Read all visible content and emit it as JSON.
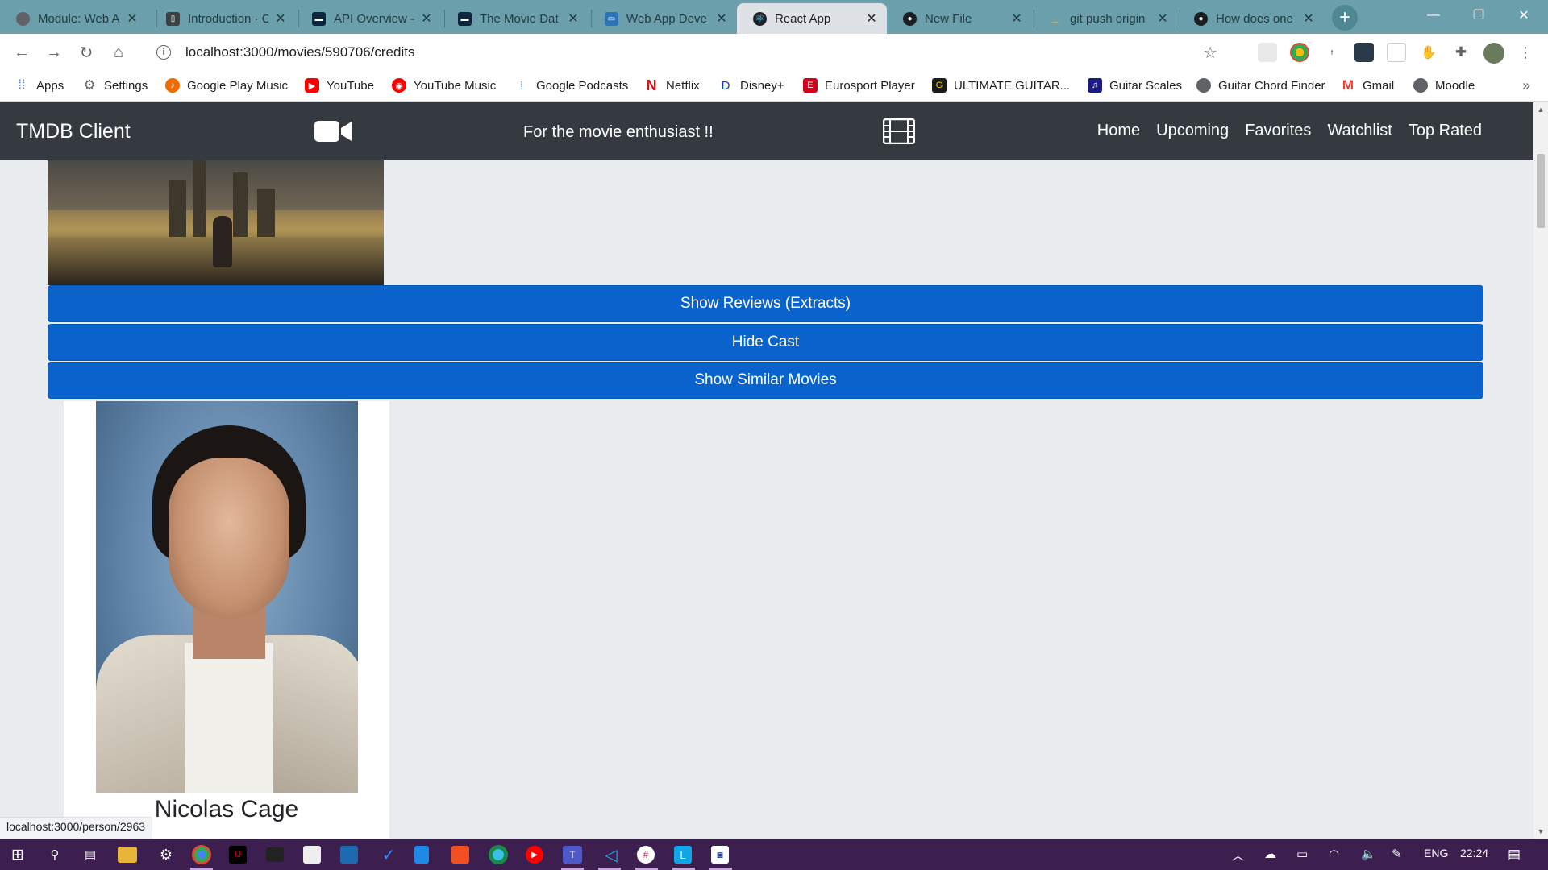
{
  "browser": {
    "tabs": [
      {
        "title": "Module: Web A",
        "favicon": "chrome-globe-icon",
        "color": "#5f6368"
      },
      {
        "title": "Introduction · C",
        "favicon": "book-icon",
        "color": "#3c4043"
      },
      {
        "title": "API Overview –",
        "favicon": "tmdb-icon",
        "color": "#0d253f"
      },
      {
        "title": "The Movie Dat",
        "favicon": "tmdb-icon",
        "color": "#0d253f"
      },
      {
        "title": "Web App Deve",
        "favicon": "moodle-course-icon",
        "color": "#2d73b8"
      },
      {
        "title": "React App",
        "favicon": "react-icon",
        "color": "#61dafb"
      },
      {
        "title": "New File",
        "favicon": "github-icon",
        "color": "#1b1f23"
      },
      {
        "title": "git push origin",
        "favicon": "generic-page-icon",
        "color": "#f0a040"
      },
      {
        "title": "How does one",
        "favicon": "github-icon",
        "color": "#1b1f23"
      }
    ],
    "active_tab_index": 5,
    "url": "localhost:3000/movies/590706/credits",
    "status_url": "localhost:3000/person/2963"
  },
  "bookmarks": [
    {
      "label": "Apps",
      "icon": "apps-grid-icon",
      "color": "#4285f4"
    },
    {
      "label": "Settings",
      "icon": "gear-icon",
      "color": "#5f6368"
    },
    {
      "label": "Google Play Music",
      "icon": "play-music-icon",
      "color": "#ef6c00"
    },
    {
      "label": "YouTube",
      "icon": "youtube-icon",
      "color": "#ff0000"
    },
    {
      "label": "YouTube Music",
      "icon": "youtube-music-icon",
      "color": "#ff0000"
    },
    {
      "label": "Google Podcasts",
      "icon": "podcasts-icon",
      "color": "#4285f4"
    },
    {
      "label": "Netflix",
      "icon": "netflix-icon",
      "color": "#e50914"
    },
    {
      "label": "Disney+",
      "icon": "disney-icon",
      "color": "#113ccf"
    },
    {
      "label": "Eurosport Player",
      "icon": "eurosport-icon",
      "color": "#d3001d"
    },
    {
      "label": "ULTIMATE GUITAR...",
      "icon": "ultimate-guitar-icon",
      "color": "#1a1a1a"
    },
    {
      "label": "Guitar Scales",
      "icon": "guitar-scales-icon",
      "color": "#1a1a80"
    },
    {
      "label": "Guitar Chord Finder",
      "icon": "globe-icon",
      "color": "#5f6368"
    },
    {
      "label": "Gmail",
      "icon": "gmail-icon",
      "color": "#ea4335"
    },
    {
      "label": "Moodle",
      "icon": "globe-icon",
      "color": "#5f6368"
    }
  ],
  "app": {
    "brand": "TMDB Client",
    "tagline": "For the movie enthusiast !!",
    "nav": [
      "Home",
      "Upcoming",
      "Favorites",
      "Watchlist",
      "Top Rated"
    ],
    "buttons": {
      "reviews": "Show Reviews (Extracts)",
      "cast": "Hide Cast",
      "similar": "Show Similar Movies"
    },
    "cast": [
      {
        "name": "Nicolas Cage"
      }
    ]
  },
  "taskbar": {
    "lang": "ENG",
    "time": "22:24"
  },
  "colors": {
    "navbar": "#343a40",
    "primary_button": "#0a63cc",
    "page_bg": "#e9ecef",
    "tabstrip": "#6b9fab",
    "taskbar": "#3d1f4f"
  }
}
